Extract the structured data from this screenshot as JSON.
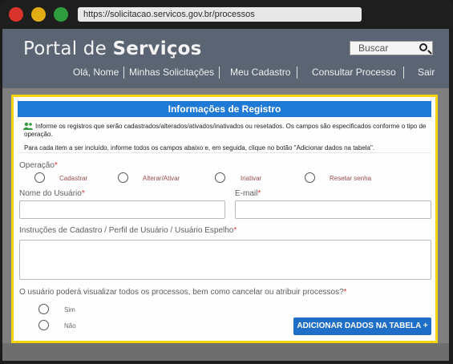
{
  "browser": {
    "url": "https://solicitacao.servicos.gov.br/processos"
  },
  "header": {
    "title_light": "Portal de ",
    "title_bold": "Serviços",
    "search_placeholder": "Buscar",
    "nav": {
      "greeting": "Olá, Nome",
      "requests": "Minhas Solicitações",
      "profile": "Meu Cadastro",
      "query": "Consultar Processo",
      "logout": "Sair"
    }
  },
  "modal": {
    "title": "Informações de Registro",
    "info_line1": "Informe os registros que serão cadastrados/alterados/ativados/inativados ou resetados. Os campos são especificados conforme o tipo de",
    "info_line2": "operação.",
    "info_line3": "Para cada item a ser incluído, informe todos os campos abaixo e, em seguida, clique no botão \"Adicionar dados na tabela\".",
    "operation_label": "Operação",
    "operations": [
      "Cadastrar",
      "Alterar/Ativar",
      "Inativar",
      "Resetar senha"
    ],
    "username_label": "Nome do Usuário",
    "email_label": "E-mail",
    "instructions_label": "Instruções de Cadastro / Perfil de Usuário / Usuário Espelho",
    "question_label": "O usuário poderá visualizar todos os processos, bem como cancelar ou atribuir processos?",
    "yes_label": "Sim",
    "no_label": "Não",
    "add_button": "ADICIONAR DADOS NA TABELA +",
    "required_mark": "*"
  }
}
